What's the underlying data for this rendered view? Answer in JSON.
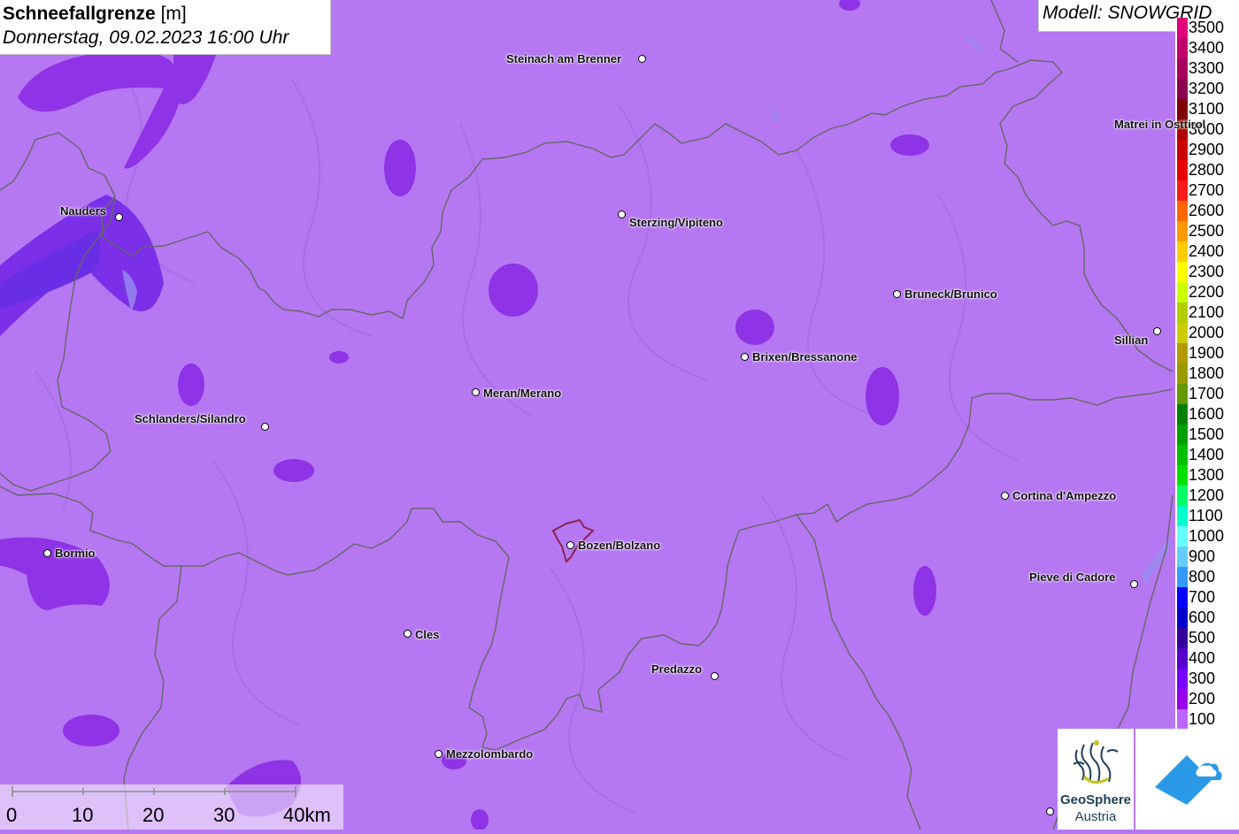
{
  "header": {
    "title": "Schneefallgrenze",
    "unit": "[m]",
    "datetime": "Donnerstag, 09.02.2023 16:00 Uhr",
    "model": "Modell: SNOWGRID"
  },
  "colors": {
    "map_base": "#b577f2",
    "border_line": "#666666",
    "highlight_outline": "#8b2252"
  },
  "legend": {
    "labels": [
      "3500",
      "3400",
      "3300",
      "3200",
      "3100",
      "3000",
      "2900",
      "2800",
      "2700",
      "2600",
      "2500",
      "2400",
      "2300",
      "2200",
      "2100",
      "2000",
      "1900",
      "1800",
      "1700",
      "1600",
      "1500",
      "1400",
      "1300",
      "1200",
      "1100",
      "1000",
      "900",
      "800",
      "700",
      "600",
      "500",
      "400",
      "300",
      "200",
      "100"
    ],
    "colors": [
      "#e0007a",
      "#c2006c",
      "#a8005e",
      "#8c0050",
      "#800000",
      "#b00000",
      "#cc0000",
      "#e60000",
      "#ff1a1a",
      "#ff6600",
      "#ff9900",
      "#ffcc00",
      "#ffff00",
      "#ccff00",
      "#b3cc00",
      "#cccc00",
      "#b39900",
      "#999900",
      "#669900",
      "#008000",
      "#00a000",
      "#00c000",
      "#00e000",
      "#00ff66",
      "#00ffcc",
      "#66ffff",
      "#66ccff",
      "#3399ff",
      "#0000ff",
      "#0000cc",
      "#330099",
      "#5500cc",
      "#7700ff",
      "#9900ee",
      "#bb66ff"
    ]
  },
  "places": [
    {
      "name": "Steinach am Brenner"
    },
    {
      "name": "Nauders"
    },
    {
      "name": "Sterzing/Vipiteno"
    },
    {
      "name": "Matrei in Osttirol"
    },
    {
      "name": "Bruneck/Brunico"
    },
    {
      "name": "Sillian"
    },
    {
      "name": "Brixen/Bressanone"
    },
    {
      "name": "Meran/Merano"
    },
    {
      "name": "Schlanders/Silandro"
    },
    {
      "name": "Cortina d'Ampezzo"
    },
    {
      "name": "Bozen/Bolzano"
    },
    {
      "name": "Bormio"
    },
    {
      "name": "Pieve di Cadore"
    },
    {
      "name": "Cles"
    },
    {
      "name": "Predazzo"
    },
    {
      "name": "Mezzolombardo"
    }
  ],
  "scale": {
    "ticks": [
      "0",
      "10",
      "20",
      "30",
      "40km"
    ]
  },
  "logo": {
    "line1": "GeoSphere",
    "line2": "Austria"
  }
}
